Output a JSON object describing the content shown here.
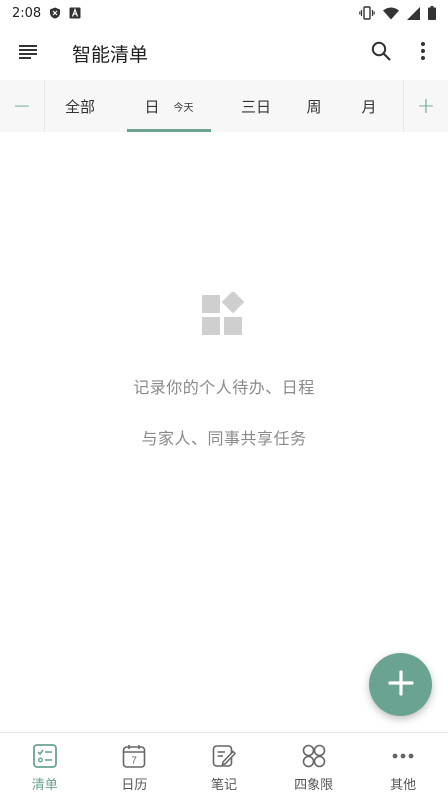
{
  "status_bar": {
    "time": "2:08",
    "icons": [
      "shield-badge-icon",
      "a-badge-icon",
      "vibrate-icon",
      "wifi-icon",
      "signal-icon",
      "battery-icon"
    ]
  },
  "app_bar": {
    "title": "智能清单",
    "icons": [
      "menu-icon",
      "search-icon",
      "more-vert-icon"
    ]
  },
  "range_bar": {
    "decrease": "−",
    "increase": "+",
    "tabs": [
      {
        "label": "全部",
        "sub": ""
      },
      {
        "label": "日",
        "sub": "今天"
      },
      {
        "label": "三日",
        "sub": ""
      },
      {
        "label": "周",
        "sub": ""
      },
      {
        "label": "月",
        "sub": ""
      }
    ],
    "active_index": 1
  },
  "empty_state": {
    "icon": "widgets-icon",
    "line1": "记录你的个人待办、日程",
    "line2": "与家人、同事共享任务"
  },
  "fab": {
    "icon": "plus-icon"
  },
  "bottom_nav": {
    "items": [
      {
        "label": "清单",
        "icon": "checklist-icon",
        "active": true
      },
      {
        "label": "日历",
        "icon": "calendar-icon",
        "day": "7"
      },
      {
        "label": "笔记",
        "icon": "note-edit-icon"
      },
      {
        "label": "四象限",
        "icon": "quadrant-icon"
      },
      {
        "label": "其他",
        "icon": "more-horiz-icon"
      }
    ]
  },
  "colors": {
    "accent": "#6aa391",
    "muted_text": "#8a8a8a",
    "tab_bar_bg": "#f7f7f7",
    "icon_gray": "#cfcfcf"
  }
}
